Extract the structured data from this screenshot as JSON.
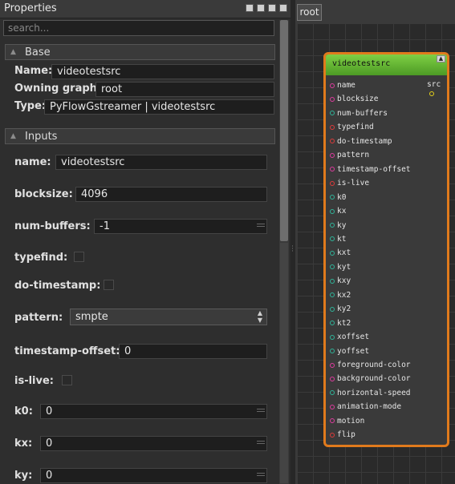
{
  "properties": {
    "title": "Properties",
    "search_placeholder": "search...",
    "base_section": "Base",
    "base": [
      {
        "label": "Name:",
        "value": "videotestsrc"
      },
      {
        "label": "Owning graph:",
        "value": "root"
      },
      {
        "label": "Type:",
        "value": "PyFlowGstreamer | videotestsrc"
      }
    ],
    "inputs_section": "Inputs",
    "inputs": {
      "name": {
        "label": "name:",
        "value": "videotestsrc"
      },
      "blocksize": {
        "label": "blocksize:",
        "value": "4096"
      },
      "num_buffers": {
        "label": "num-buffers:",
        "value": "-1"
      },
      "typefind": {
        "label": "typefind:"
      },
      "do_timestamp": {
        "label": "do-timestamp:"
      },
      "pattern": {
        "label": "pattern:",
        "value": "smpte"
      },
      "timestamp_offset": {
        "label": "timestamp-offset:",
        "value": "0"
      },
      "is_live": {
        "label": "is-live:"
      },
      "k0": {
        "label": "k0:",
        "value": "0"
      },
      "kx": {
        "label": "kx:",
        "value": "0"
      },
      "ky": {
        "label": "ky:",
        "value": "0"
      }
    }
  },
  "graph": {
    "tab": "root",
    "node": {
      "title": "videotestsrc",
      "output": "src",
      "output_color": "#e6d21a",
      "ports": [
        {
          "name": "name",
          "color": "#e03ca0"
        },
        {
          "name": "blocksize",
          "color": "#e03ca0"
        },
        {
          "name": "num-buffers",
          "color": "#2fb59a"
        },
        {
          "name": "typefind",
          "color": "#e03a3a"
        },
        {
          "name": "do-timestamp",
          "color": "#e03a3a"
        },
        {
          "name": "pattern",
          "color": "#e03ca0"
        },
        {
          "name": "timestamp-offset",
          "color": "#e03ca0"
        },
        {
          "name": "is-live",
          "color": "#e03a3a"
        },
        {
          "name": "k0",
          "color": "#2fb59a"
        },
        {
          "name": "kx",
          "color": "#2fb59a"
        },
        {
          "name": "ky",
          "color": "#2fb59a"
        },
        {
          "name": "kt",
          "color": "#2fb59a"
        },
        {
          "name": "kxt",
          "color": "#2fb59a"
        },
        {
          "name": "kyt",
          "color": "#2fb59a"
        },
        {
          "name": "kxy",
          "color": "#2fb59a"
        },
        {
          "name": "kx2",
          "color": "#2fb59a"
        },
        {
          "name": "ky2",
          "color": "#2fb59a"
        },
        {
          "name": "kt2",
          "color": "#2fb59a"
        },
        {
          "name": "xoffset",
          "color": "#2fb59a"
        },
        {
          "name": "yoffset",
          "color": "#2fb59a"
        },
        {
          "name": "foreground-color",
          "color": "#e03ca0"
        },
        {
          "name": "background-color",
          "color": "#e03ca0"
        },
        {
          "name": "horizontal-speed",
          "color": "#2fb59a"
        },
        {
          "name": "animation-mode",
          "color": "#e03ca0"
        },
        {
          "name": "motion",
          "color": "#e03ca0"
        },
        {
          "name": "flip",
          "color": "#e03a3a"
        }
      ]
    }
  }
}
